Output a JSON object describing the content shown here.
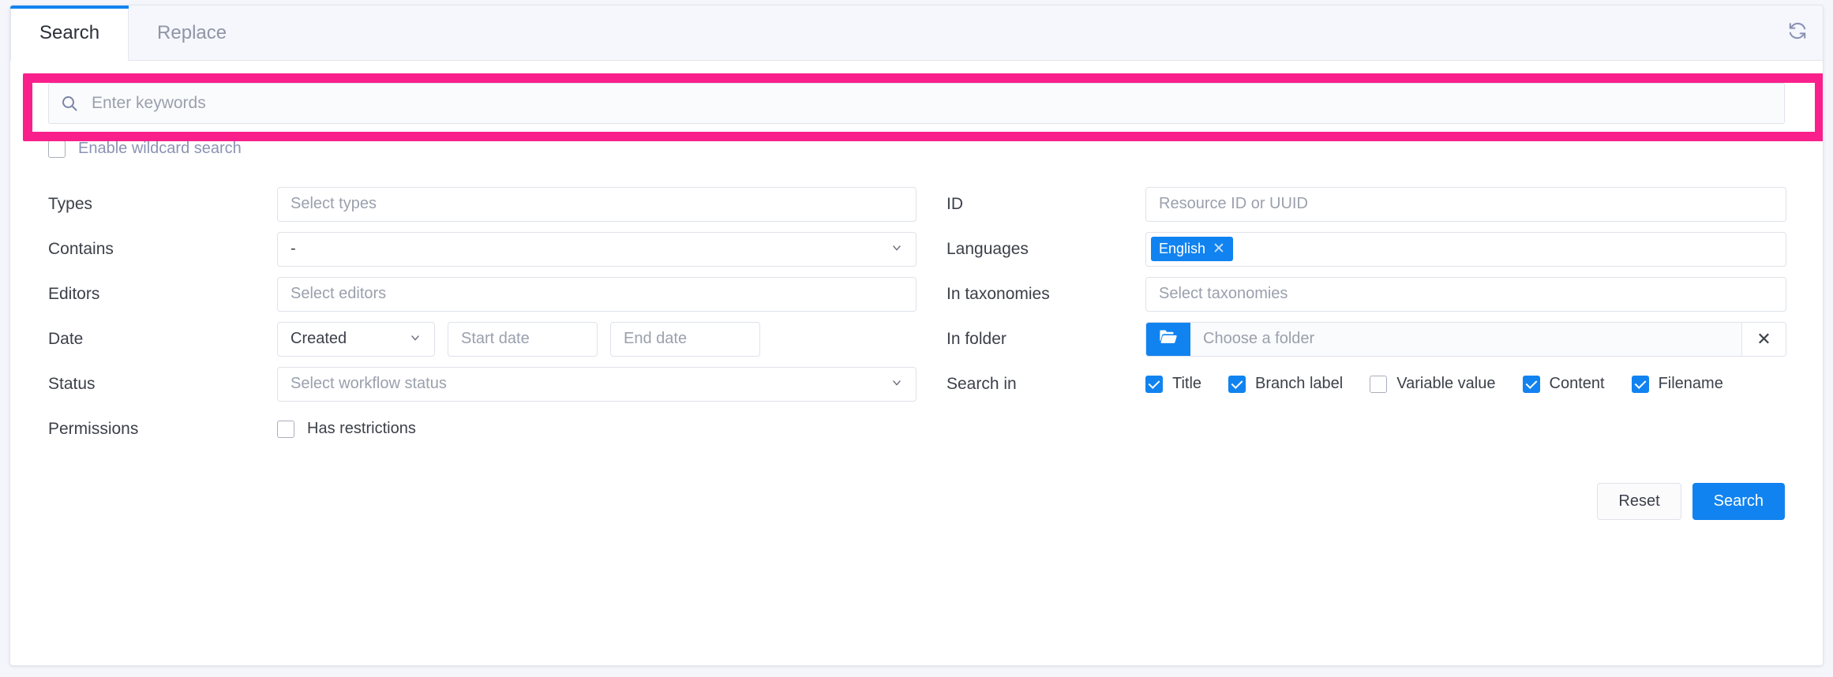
{
  "tabs": [
    {
      "label": "Search",
      "active": true
    },
    {
      "label": "Replace",
      "active": false
    }
  ],
  "toolbar": {
    "refresh_icon": "refresh-icon"
  },
  "search": {
    "keyword_placeholder": "Enter keywords",
    "keyword_value": "",
    "search_icon": "search-icon",
    "wildcard_label": "Enable wildcard search",
    "wildcard_checked": false,
    "highlight_color": "#f9208c"
  },
  "fields": {
    "types": {
      "label": "Types",
      "placeholder": "Select types",
      "value": ""
    },
    "id": {
      "label": "ID",
      "placeholder": "Resource ID or UUID",
      "value": ""
    },
    "contains": {
      "label": "Contains",
      "value": "-"
    },
    "languages": {
      "label": "Languages",
      "chips": [
        {
          "text": "English",
          "remove_icon": "close-icon"
        }
      ]
    },
    "editors": {
      "label": "Editors",
      "placeholder": "Select editors",
      "value": ""
    },
    "in_taxonomies": {
      "label": "In taxonomies",
      "placeholder": "Select taxonomies",
      "value": ""
    },
    "date": {
      "label": "Date",
      "type_value": "Created",
      "start_placeholder": "Start date",
      "start_value": "",
      "end_placeholder": "End date",
      "end_value": ""
    },
    "in_folder": {
      "label": "In folder",
      "placeholder": "Choose a folder",
      "value": "",
      "browse_icon": "folder-open-icon",
      "clear_icon": "close-icon"
    },
    "status": {
      "label": "Status",
      "placeholder": "Select workflow status",
      "value": ""
    },
    "search_in": {
      "label": "Search in",
      "options": [
        {
          "label": "Title",
          "checked": true
        },
        {
          "label": "Branch label",
          "checked": true
        },
        {
          "label": "Variable value",
          "checked": false
        },
        {
          "label": "Content",
          "checked": true
        },
        {
          "label": "Filename",
          "checked": true
        }
      ]
    },
    "permissions": {
      "label": "Permissions",
      "restriction_label": "Has restrictions",
      "restriction_checked": false
    }
  },
  "footer": {
    "reset_label": "Reset",
    "search_label": "Search"
  },
  "colors": {
    "accent": "#1183f0",
    "highlight": "#f9208c",
    "page_bg": "#f4f6fb"
  }
}
